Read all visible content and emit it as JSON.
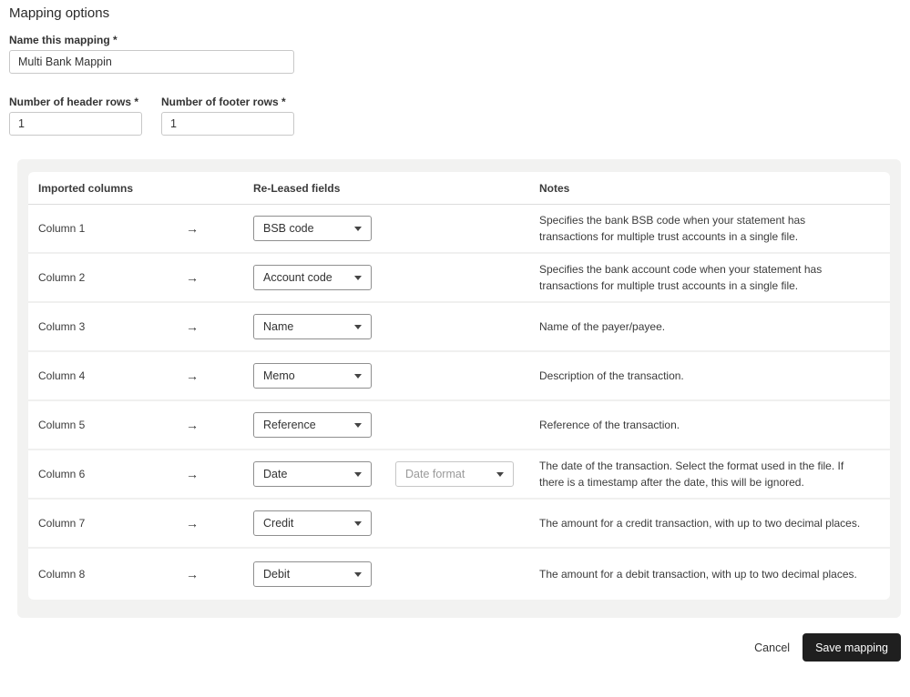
{
  "page_title": "Mapping options",
  "form": {
    "name_label": "Name this mapping *",
    "name_value": "Multi Bank Mappin",
    "header_rows_label": "Number of header rows *",
    "header_rows_value": "1",
    "footer_rows_label": "Number of footer rows *",
    "footer_rows_value": "1"
  },
  "table": {
    "headers": {
      "imported_columns": "Imported columns",
      "fields": "Re-Leased fields",
      "notes": "Notes"
    },
    "arrow_icon": "→",
    "rows": [
      {
        "column": "Column 1",
        "field": "BSB code",
        "note": "Specifies the bank BSB code when your statement has transactions for multiple trust accounts in a single file."
      },
      {
        "column": "Column 2",
        "field": "Account code",
        "note": "Specifies the bank account code when your statement has transactions for multiple trust accounts in a single file."
      },
      {
        "column": "Column 3",
        "field": "Name",
        "note": "Name of the payer/payee."
      },
      {
        "column": "Column 4",
        "field": "Memo",
        "note": "Description of the transaction."
      },
      {
        "column": "Column 5",
        "field": "Reference",
        "note": "Reference of the transaction."
      },
      {
        "column": "Column 6",
        "field": "Date",
        "format_placeholder": "Date format",
        "note": "The date of the transaction. Select the format used in the file. If there is a timestamp after the date, this will be ignored."
      },
      {
        "column": "Column 7",
        "field": "Credit",
        "note": "The amount for a credit transaction, with up to two decimal places."
      },
      {
        "column": "Column 8",
        "field": "Debit",
        "note": "The amount for a debit transaction, with up to two decimal places."
      }
    ]
  },
  "footer": {
    "cancel_label": "Cancel",
    "save_label": "Save mapping"
  },
  "colors": {
    "panel_bg": "#f2f2f1",
    "save_button_bg": "#1f1f1f",
    "text": "#3b3b3b",
    "dropdown_border": "#8f8f8f",
    "placeholder_text": "#9a9a9a"
  }
}
